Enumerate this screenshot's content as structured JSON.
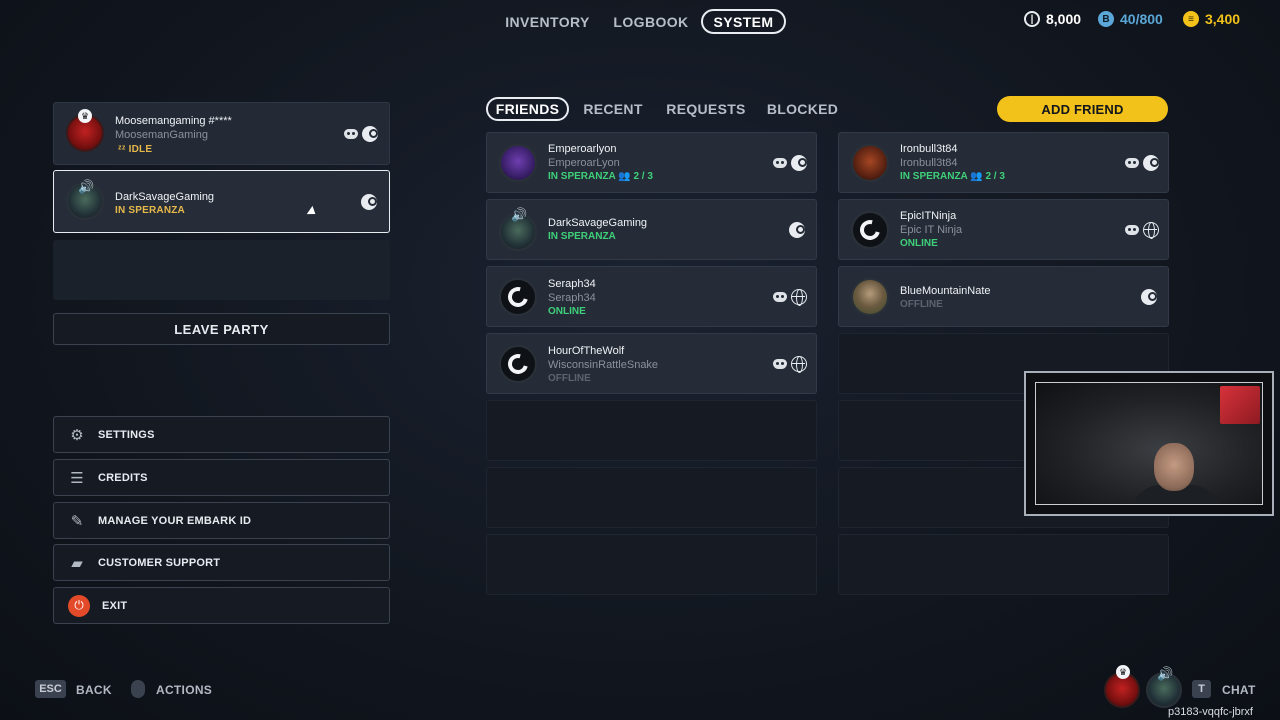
{
  "nav": {
    "tabs": [
      "INVENTORY",
      "LOGBOOK",
      "SYSTEM"
    ],
    "active": "SYSTEM"
  },
  "currency": [
    {
      "icon": "coin-icon",
      "value": "8,000",
      "color": "#ffffff"
    },
    {
      "icon": "embark-token-icon",
      "value": "40/800",
      "color": "#5aa7d8"
    },
    {
      "icon": "gold-bars-icon",
      "value": "3,400",
      "color": "#f2c21b"
    }
  ],
  "party": {
    "members": [
      {
        "name": "Moosemangaming #****",
        "handle": "MoosemanGaming",
        "status": "IDLE",
        "platforms": [
          "discord",
          "steam"
        ]
      },
      {
        "name": "DarkSavageGaming",
        "status": "IN SPERANZA",
        "platforms": [
          "steam"
        ]
      }
    ],
    "leave_label": "LEAVE PARTY"
  },
  "menu": [
    {
      "label": "SETTINGS",
      "icon": "gear-icon"
    },
    {
      "label": "CREDITS",
      "icon": "credits-list-icon"
    },
    {
      "label": "MANAGE YOUR EMBARK ID",
      "icon": "id-icon"
    },
    {
      "label": "CUSTOMER SUPPORT",
      "icon": "chat-bubbles-icon"
    },
    {
      "label": "EXIT",
      "icon": "power-icon"
    }
  ],
  "friends_tabs": [
    "FRIENDS",
    "RECENT",
    "REQUESTS",
    "BLOCKED"
  ],
  "friends_active": "FRIENDS",
  "add_friend_label": "ADD FRIEND",
  "friends": [
    {
      "name": "Emperoarlyon",
      "handle": "EmperoarLyon",
      "status": "IN SPERANZA",
      "party": "2 / 3",
      "platforms": [
        "discord",
        "steam"
      ]
    },
    {
      "name": "Ironbull3t84",
      "handle": "Ironbull3t84",
      "status": "IN SPERANZA",
      "party": "2 / 3",
      "platforms": [
        "discord",
        "steam"
      ]
    },
    {
      "name": "DarkSavageGaming",
      "status": "IN SPERANZA",
      "platforms": [
        "steam"
      ]
    },
    {
      "name": "EpicITNinja",
      "handle": "Epic IT Ninja",
      "status": "ONLINE",
      "platforms": [
        "discord",
        "web"
      ]
    },
    {
      "name": "Seraph34",
      "handle": "Seraph34",
      "status": "ONLINE",
      "platforms": [
        "discord",
        "web"
      ]
    },
    {
      "name": "BlueMountainNate",
      "status": "OFFLINE",
      "platforms": [
        "steam"
      ]
    },
    {
      "name": "HourOfTheWolf",
      "handle": "WisconsinRattleSnake",
      "status": "OFFLINE",
      "platforms": [
        "discord",
        "web"
      ]
    }
  ],
  "bottom": {
    "esc_key": "ESC",
    "back_label": "BACK",
    "actions_label": "ACTIONS",
    "chat_key": "T",
    "chat_label": "CHAT",
    "player_id": "p3183-vqqfc-jbrxf"
  }
}
